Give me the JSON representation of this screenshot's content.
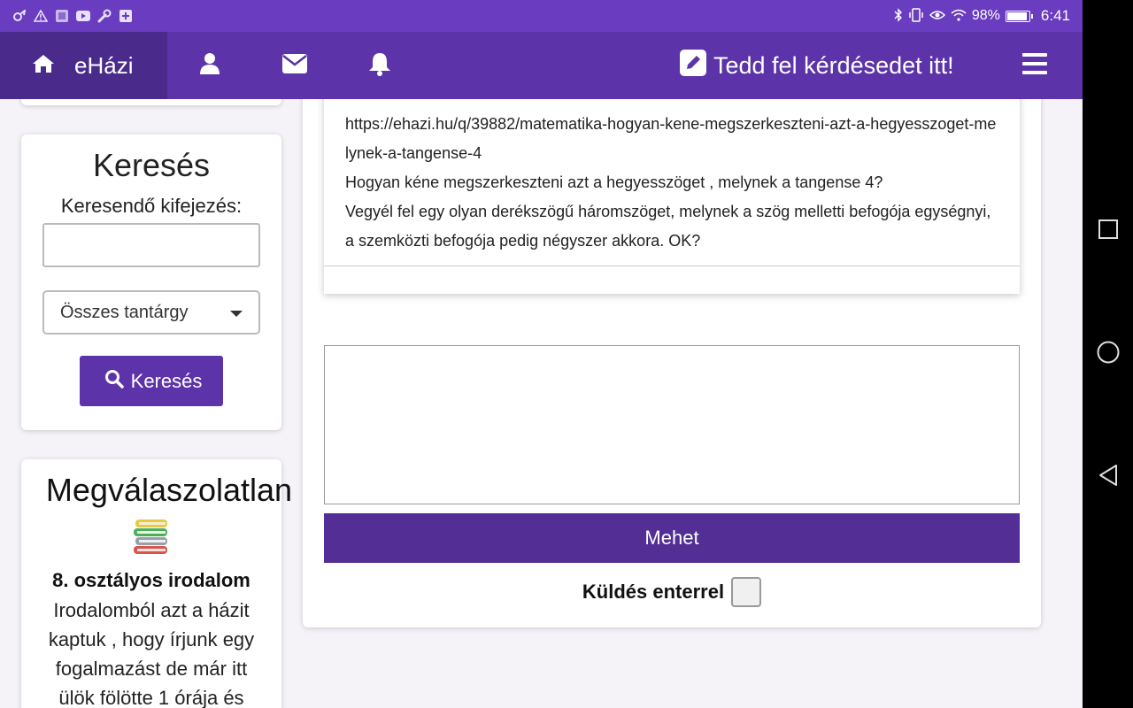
{
  "status_bar": {
    "battery_percent": "98%",
    "time": "6:41",
    "battery_level": 0.98,
    "left_icons": [
      "squirrel-icon",
      "warning-icon",
      "app-icon",
      "youtube-icon",
      "wrench-icon",
      "plus-box-icon"
    ],
    "right_icons": [
      "bluetooth-icon",
      "vibrate-icon",
      "eye-icon",
      "wifi-icon"
    ]
  },
  "navbar": {
    "brand": "eHázi",
    "ask_label": "Tedd fel kérdésedet itt!",
    "icons": [
      "home-icon",
      "user-icon",
      "envelope-icon",
      "bell-icon",
      "edit-icon",
      "hamburger-menu-icon"
    ]
  },
  "search": {
    "title": "Keresés",
    "label": "Keresendő kifejezés:",
    "input_value": "",
    "subject_select": "Összes tantárgy",
    "button_label": "Keresés"
  },
  "unanswered": {
    "title": "Megválaszolatlan",
    "subject": "8. osztályos irodalom",
    "text": "Irodalomból azt a házit kaptuk , hogy írjunk egy fogalmazást de már itt ülök fölötte 1 órája és"
  },
  "answer": {
    "url": "https://ehazi.hu/q/39882/matematika-hogyan-kene-megszerkeszteni-azt-a-hegyesszoget-melynek-a-tangense-4",
    "question": "Hogyan kéne megszerkeszteni azt a hegyesszöget , melynek a tangense 4?",
    "reply": "Vegyél fel egy olyan derékszögű háromszöget, melynek a szög melletti befogója egységnyi, a szemközti befogója pedig négyszer akkora. OK?"
  },
  "reply_form": {
    "textarea_value": "",
    "submit_label": "Mehet",
    "send_with_enter_label": "Küldés enterrel",
    "send_with_enter_checked": false
  },
  "colors": {
    "status_bar": "#6a3cc0",
    "navbar": "#5c33a8",
    "nav_home_active": "#4a2a8a",
    "button": "#522e95"
  }
}
